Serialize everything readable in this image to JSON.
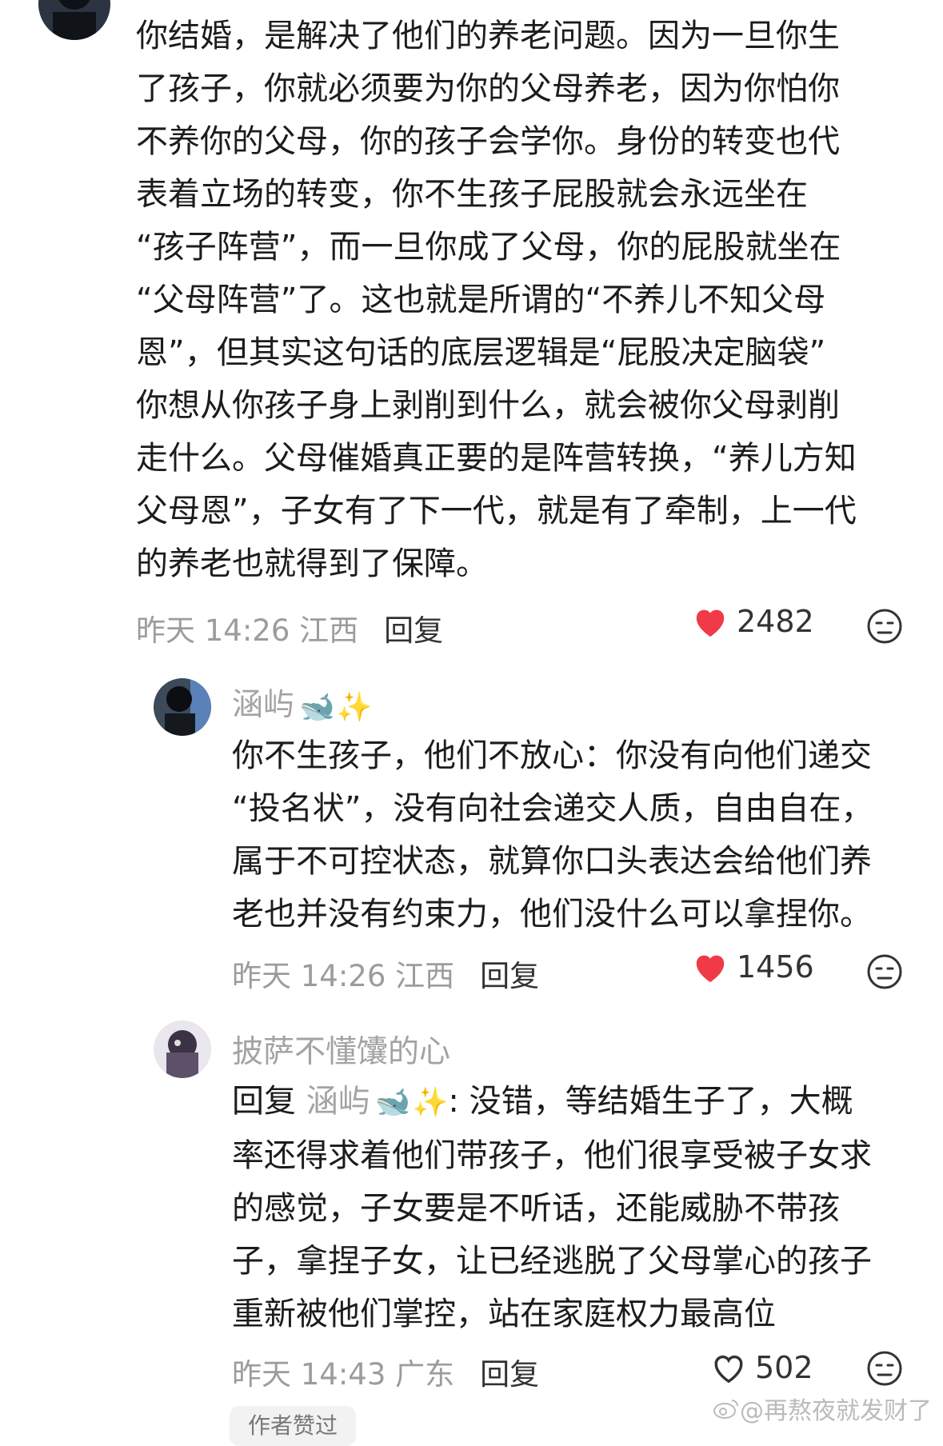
{
  "comments": [
    {
      "text_lines": [
        "你结婚，是解决了他们的养老问题。因为一旦你生",
        "了孩子，你就必须要为你的父母养老，因为你怕你",
        "不养你的父母，你的孩子会学你。身份的转变也代",
        "表着立场的转变，你不生孩子屁股就会永远坐在",
        "“孩子阵营”，而一旦你成了父母，你的屁股就坐在",
        "“父母阵营”了。这也就是所谓的“不养儿不知父母",
        "恩”，但其实这句话的底层逻辑是“屁股决定脑袋”",
        "你想从你孩子身上剥削到什么，就会被你父母剥削",
        "走什么。父母催婚真正要的是阵营转换，“养儿方知",
        "父母恩”，子女有了下一代，就是有了牵制，上一代",
        "的养老也就得到了保障。"
      ],
      "time": "昨天 14:26 江西",
      "reply_label": "回复",
      "likes": "2482",
      "liked": true
    },
    {
      "author": "涵屿",
      "author_emoji": [
        "🐋",
        "✨"
      ],
      "text_lines": [
        "你不生孩子，他们不放心：你没有向他们递交",
        "“投名状”，没有向社会递交人质，自由自在，",
        "属于不可控状态，就算你口头表达会给他们养",
        "老也并没有约束力，他们没什么可以拿捏你。"
      ],
      "time": "昨天 14:26 江西",
      "reply_label": "回复",
      "likes": "1456",
      "liked": true
    },
    {
      "author": "披萨不懂馕的心",
      "reply_prefix": "回复",
      "reply_target": "涵屿",
      "reply_target_emoji": [
        "🐋",
        "✨"
      ],
      "reply_first_line": ": 没错，等结婚生子了，大概",
      "text_lines": [
        "率还得求着他们带孩子，他们很享受被子女求",
        "的感觉，子女要是不听话，还能威胁不带孩",
        "子，拿捏子女，让已经逃脱了父母掌心的孩子",
        "重新被他们掌控，站在家庭权力最高位"
      ],
      "time": "昨天 14:43 广东",
      "reply_label": "回复",
      "likes": "502",
      "liked": false
    }
  ],
  "badge": "作者赞过",
  "watermark": "@再熬夜就发财了",
  "colors": {
    "like_red": "#f03a47",
    "meta_gray": "#9c9c9c",
    "name_gray": "#a3a3a3"
  }
}
